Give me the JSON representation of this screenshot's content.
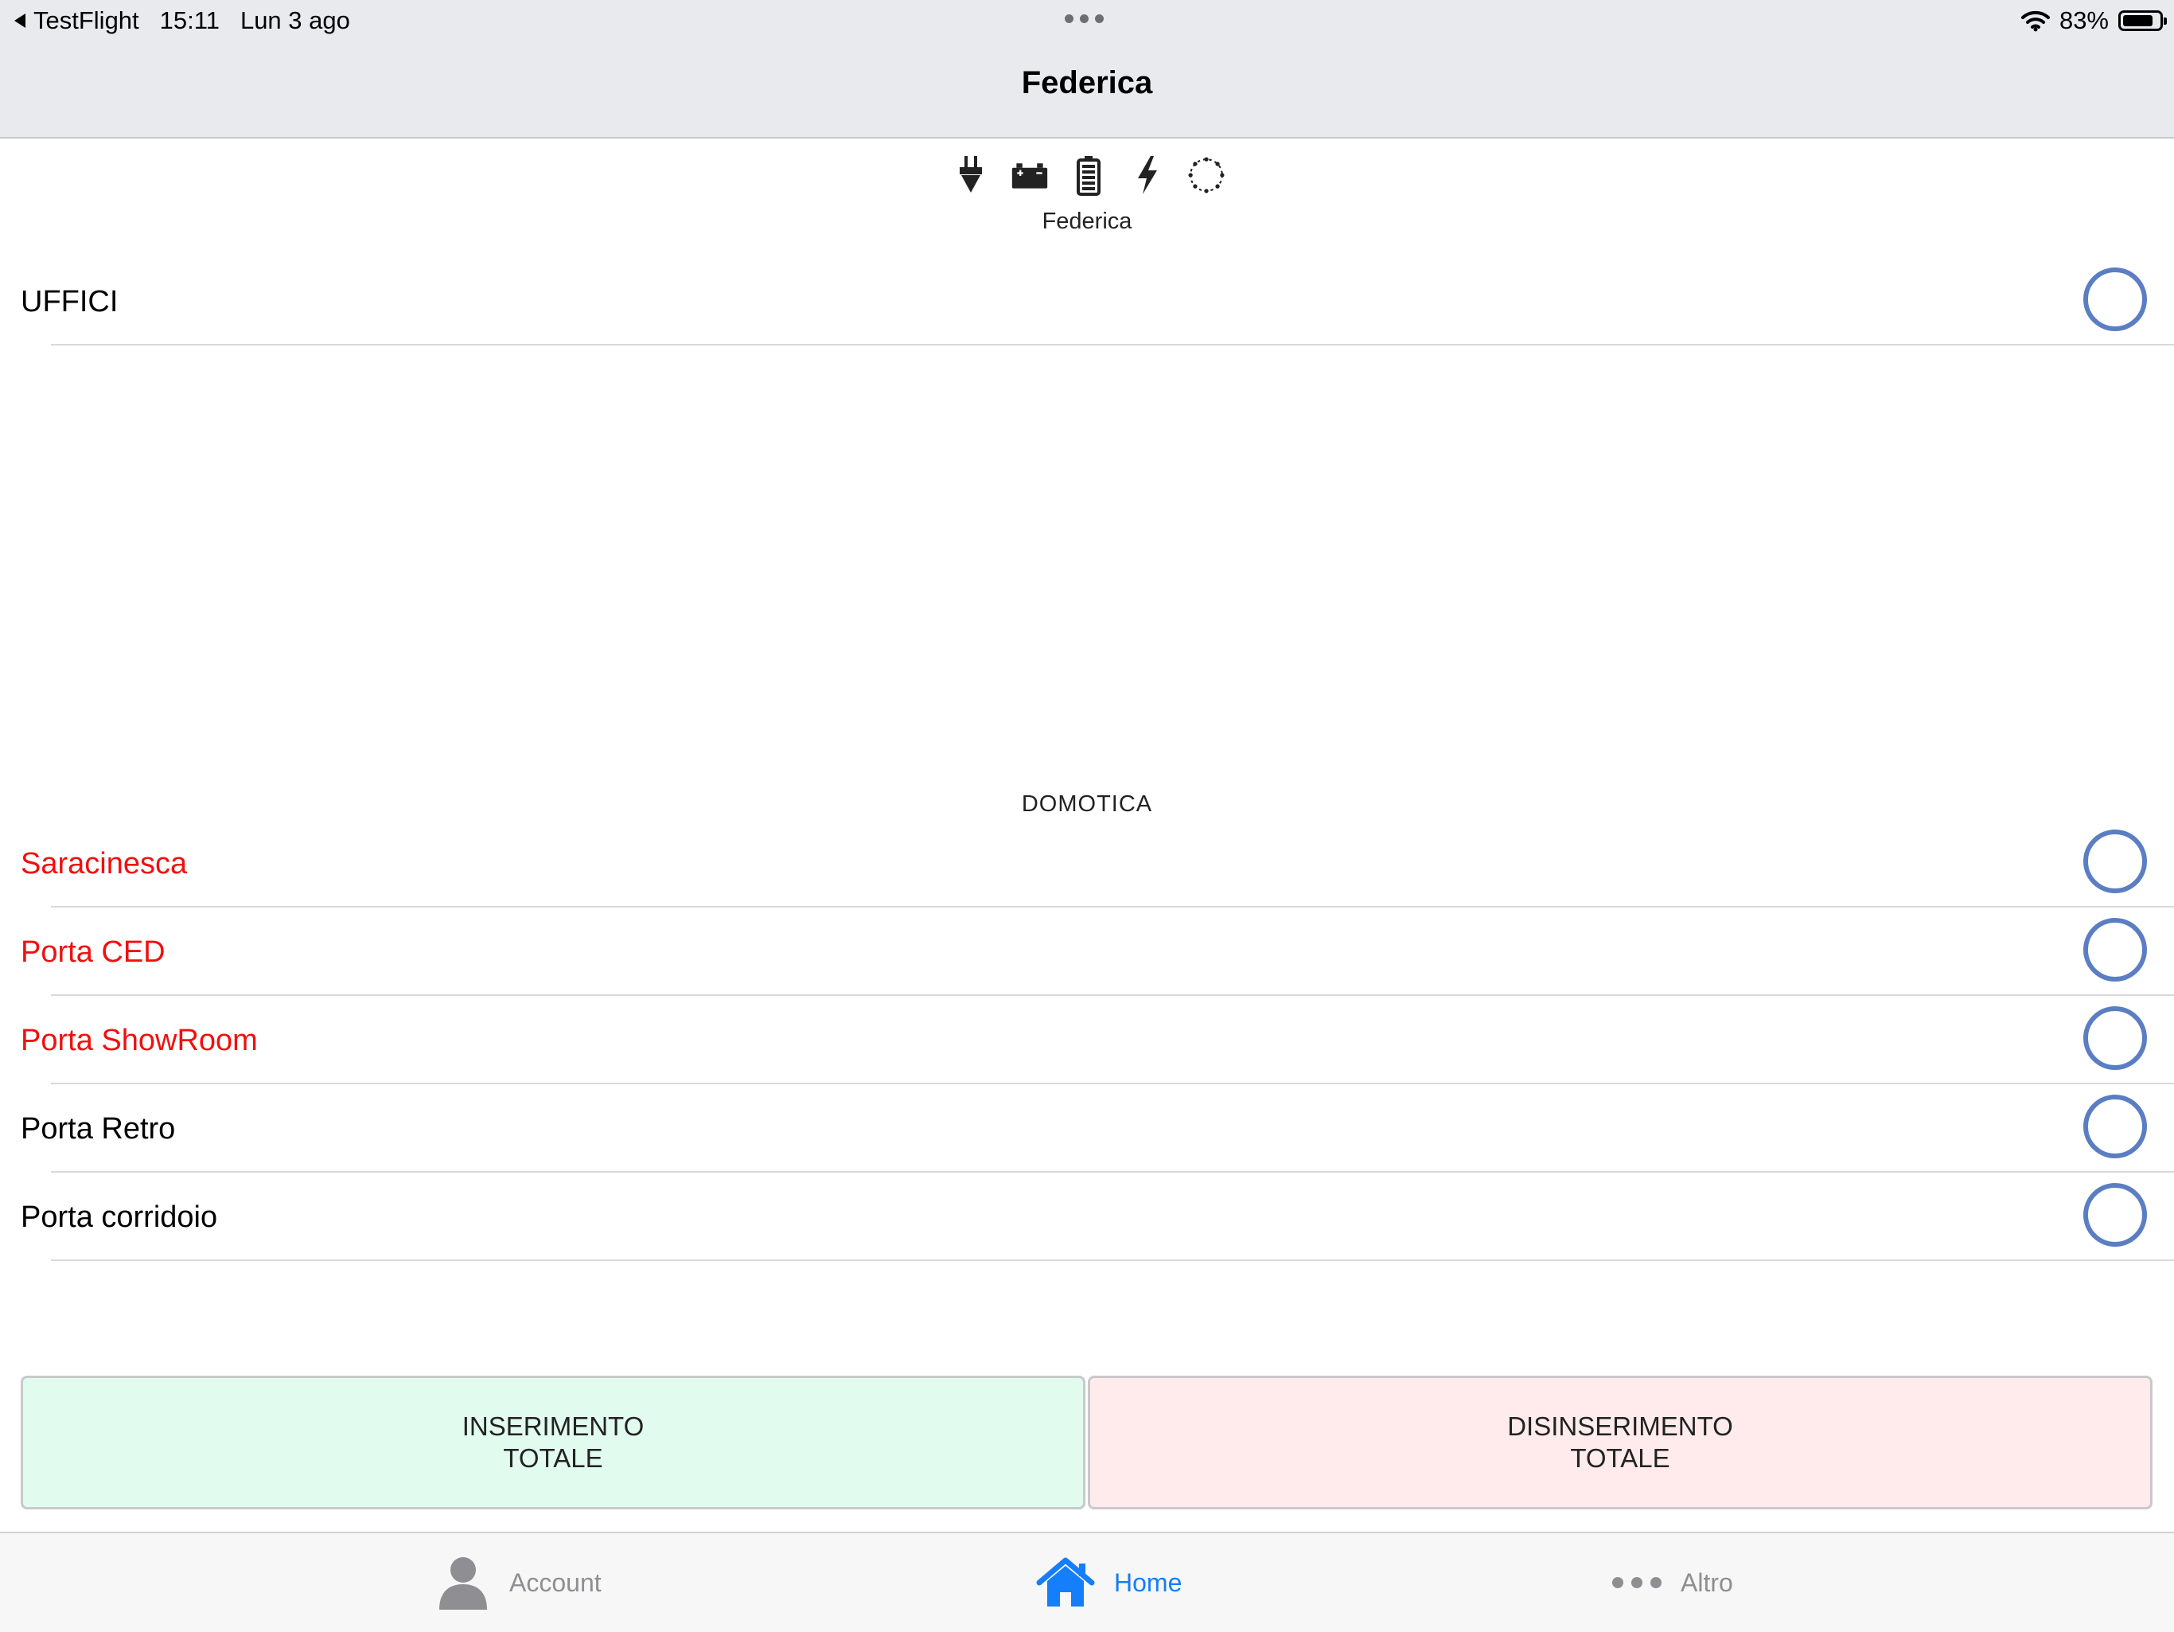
{
  "status_bar": {
    "back_app": "TestFlight",
    "time": "15:11",
    "date": "Lun 3 ago",
    "battery_percent": "83%",
    "battery_level": 0.83
  },
  "nav": {
    "title": "Federica"
  },
  "header": {
    "icons": [
      "plug-icon",
      "car-battery-icon",
      "battery-icon",
      "lightning-icon",
      "dotted-circle-icon"
    ],
    "panel_name": "Federica"
  },
  "areas": [
    {
      "label": "UFFICI",
      "color": "#000000"
    }
  ],
  "domotica": {
    "title": "DOMOTICA",
    "items": [
      {
        "label": "Saracinesca",
        "color": "#f20f0f"
      },
      {
        "label": "Porta CED",
        "color": "#f20f0f"
      },
      {
        "label": "Porta ShowRoom",
        "color": "#f20f0f"
      },
      {
        "label": "Porta Retro",
        "color": "#000000"
      },
      {
        "label": "Porta corridoio",
        "color": "#000000"
      }
    ]
  },
  "buttons": {
    "arm_line1": "INSERIMENTO",
    "arm_line2": "TOTALE",
    "disarm_line1": "DISINSERIMENTO",
    "disarm_line2": "TOTALE"
  },
  "tabs": {
    "account": "Account",
    "home": "Home",
    "altro": "Altro",
    "active": "Home"
  },
  "colors": {
    "ring": "#5b7ec3",
    "active_tab": "#147efb",
    "arm_bg": "#e2fbef",
    "disarm_bg": "#ffebeb"
  }
}
